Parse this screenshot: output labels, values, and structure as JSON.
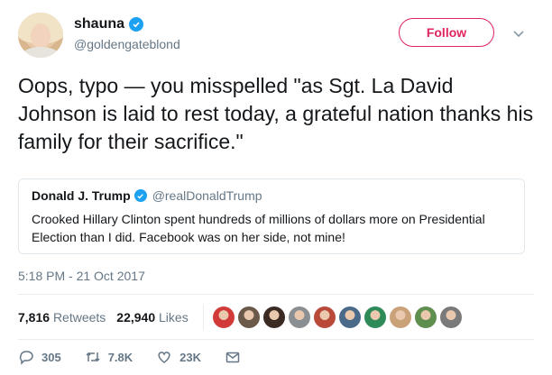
{
  "author": {
    "display_name": "shauna",
    "handle": "@goldengateblond",
    "verified_icon": "verified-badge-icon"
  },
  "follow_button": {
    "label": "Follow",
    "color": "#e0245e"
  },
  "tweet": {
    "text": "Oops, typo — you misspelled \"as Sgt. La David Johnson is laid to rest today, a grateful nation thanks his family for their sacrifice.\""
  },
  "quoted_tweet": {
    "display_name": "Donald J. Trump",
    "handle": "@realDonaldTrump",
    "text": "Crooked Hillary Clinton spent hundreds of millions of dollars more on Presidential Election than I did. Facebook was on her side, not mine!"
  },
  "timestamp": "5:18 PM - 21 Oct 2017",
  "stats": {
    "retweets_count": "7,816",
    "retweets_label": "Retweets",
    "likes_count": "22,940",
    "likes_label": "Likes"
  },
  "likers": [
    {
      "color": "#d23a3a"
    },
    {
      "color": "#6b5a4a"
    },
    {
      "color": "#3a2a22"
    },
    {
      "color": "#8a8f94"
    },
    {
      "color": "#b94a3a"
    },
    {
      "color": "#4a6a8a"
    },
    {
      "color": "#2e8b57"
    },
    {
      "color": "#c9a27a"
    },
    {
      "color": "#5f8f4f"
    },
    {
      "color": "#7a7a7a"
    }
  ],
  "actions": {
    "reply_count": "305",
    "retweet_count": "7.8K",
    "like_count": "23K"
  },
  "colors": {
    "accent_blue": "#1da1f2",
    "secondary_text": "#657786",
    "border": "#e1e8ed"
  }
}
